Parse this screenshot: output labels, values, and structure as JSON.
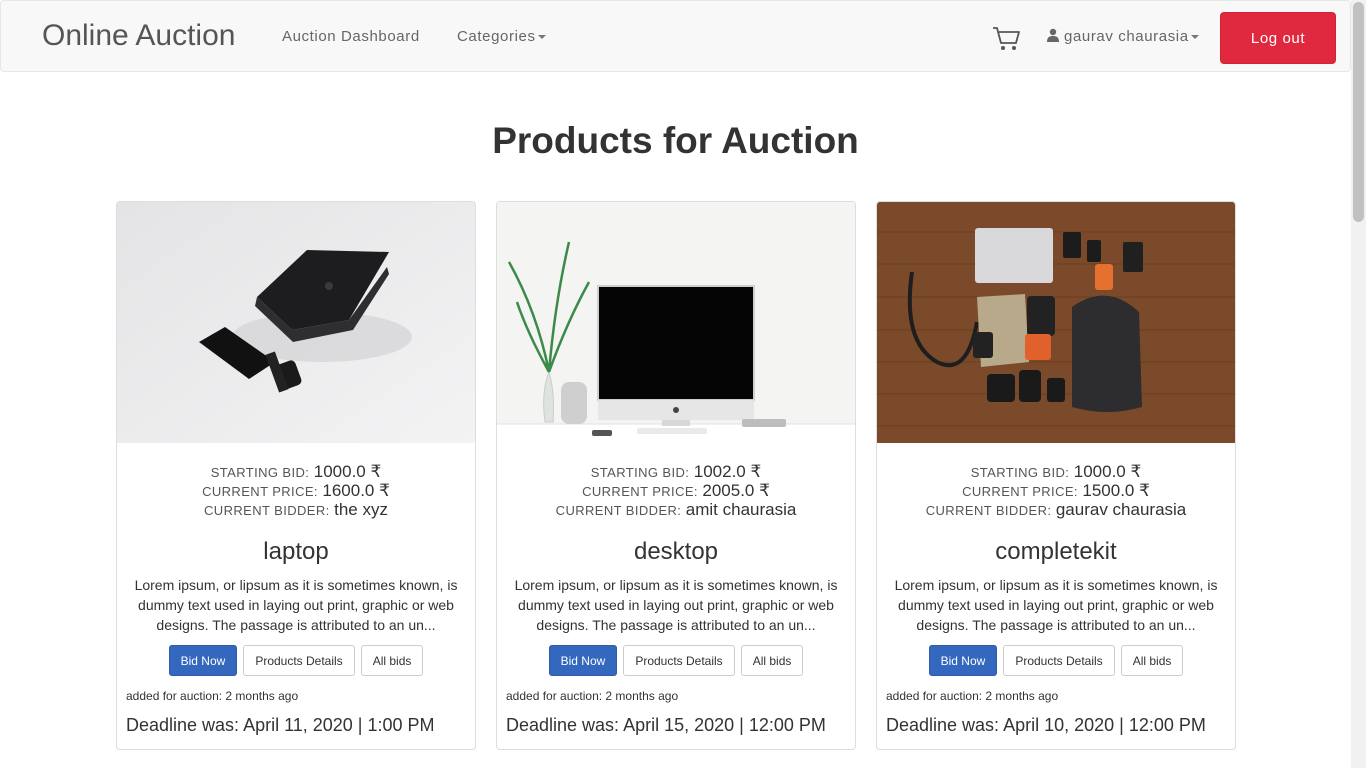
{
  "nav": {
    "brand": "Online Auction",
    "dashboard": "Auction Dashboard",
    "categories": "Categories",
    "user": "gaurav chaurasia",
    "logout": "Log out"
  },
  "page": {
    "title": "Products for Auction"
  },
  "labels": {
    "starting_bid": "STARTING BID:",
    "current_price": "CURRENT PRICE:",
    "current_bidder": "CURRENT BIDDER:",
    "bid_now": "Bid Now",
    "details": "Products Details",
    "all_bids": "All bids"
  },
  "products": [
    {
      "name": "laptop",
      "starting_bid": "1000.0 ₹",
      "current_price": "1600.0 ₹",
      "current_bidder": "the xyz",
      "description": "Lorem ipsum, or lipsum as it is sometimes known, is dummy text used in laying out print, graphic or web designs. The passage is attributed to an un...",
      "added": "added for auction: 2 months ago",
      "deadline": "Deadline was: April 11, 2020 | 1:00 PM"
    },
    {
      "name": "desktop",
      "starting_bid": "1002.0 ₹",
      "current_price": "2005.0 ₹",
      "current_bidder": "amit chaurasia",
      "description": "Lorem ipsum, or lipsum as it is sometimes known, is dummy text used in laying out print, graphic or web designs. The passage is attributed to an un...",
      "added": "added for auction: 2 months ago",
      "deadline": "Deadline was: April 15, 2020 | 12:00 PM"
    },
    {
      "name": "completekit",
      "starting_bid": "1000.0 ₹",
      "current_price": "1500.0 ₹",
      "current_bidder": "gaurav chaurasia",
      "description": "Lorem ipsum, or lipsum as it is sometimes known, is dummy text used in laying out print, graphic or web designs. The passage is attributed to an un...",
      "added": "added for auction: 2 months ago",
      "deadline": "Deadline was: April 10, 2020 | 12:00 PM"
    }
  ],
  "colors": {
    "logout": "#e0293f",
    "primary_button": "#3468bf",
    "navbar": "#f8f8f8"
  },
  "icons": {
    "cart": "cart-icon",
    "user": "user-icon",
    "caret": "chevron-down-icon"
  }
}
